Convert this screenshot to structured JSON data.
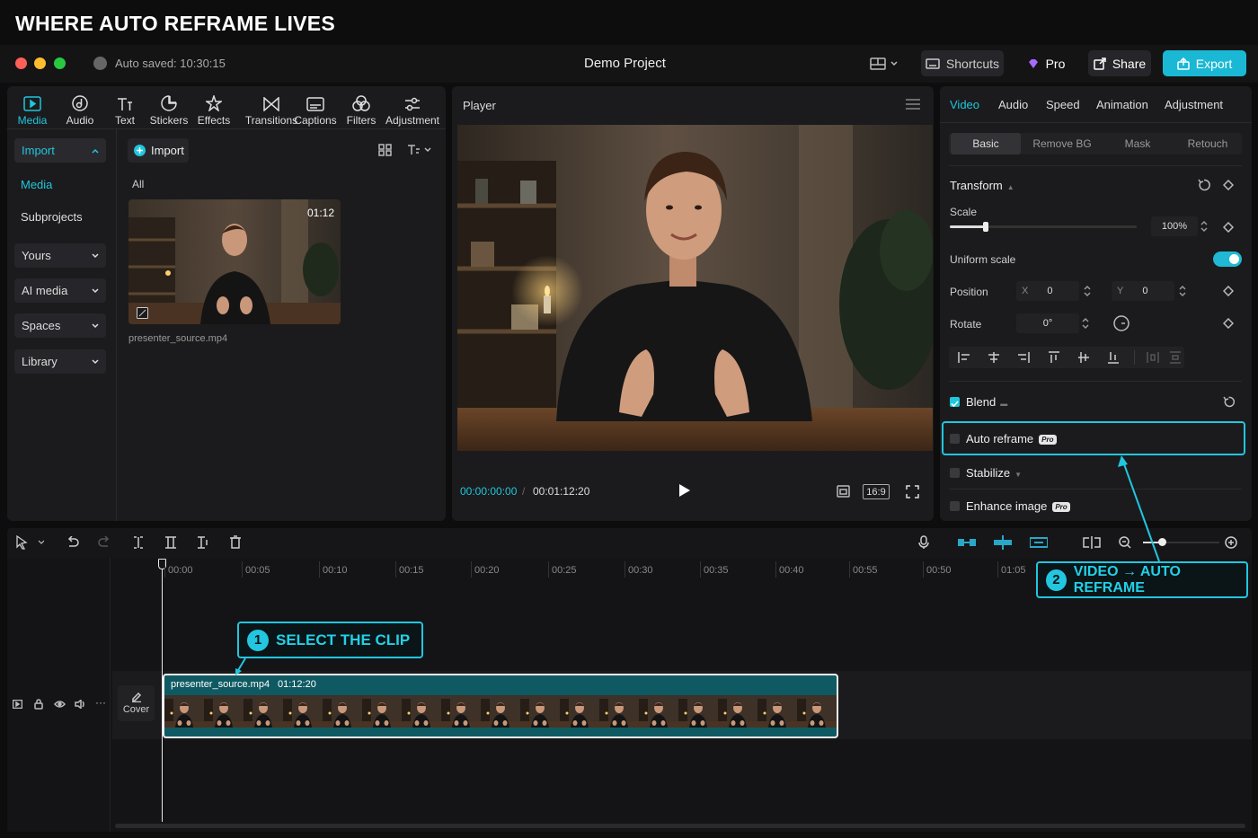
{
  "heading": "WHERE AUTO REFRAME LIVES",
  "titlebar": {
    "autosave": "Auto saved: 10:30:15",
    "project": "Demo Project",
    "shortcuts": "Shortcuts",
    "pro": "Pro",
    "share": "Share",
    "export": "Export"
  },
  "toolbar": {
    "tabs": [
      {
        "label": "Media",
        "icon": "media-icon"
      },
      {
        "label": "Audio",
        "icon": "audio-icon"
      },
      {
        "label": "Text",
        "icon": "text-icon"
      },
      {
        "label": "Stickers",
        "icon": "stickers-icon"
      },
      {
        "label": "Effects",
        "icon": "effects-icon"
      },
      {
        "label": "Transitions",
        "icon": "transitions-icon"
      },
      {
        "label": "Captions",
        "icon": "captions-icon"
      },
      {
        "label": "Filters",
        "icon": "filters-icon"
      },
      {
        "label": "Adjustment",
        "icon": "adjustment-icon"
      }
    ]
  },
  "sidebar": {
    "import": "Import",
    "media": "Media",
    "subprojects": "Subprojects",
    "dropdowns": [
      "Yours",
      "AI media",
      "Spaces",
      "Library"
    ]
  },
  "media": {
    "import_button": "Import",
    "filter": "All",
    "clip_duration": "01:12",
    "clip_name": "presenter_source.mp4"
  },
  "player": {
    "title": "Player",
    "current_time": "00:00:00:00",
    "total_time": "00:01:12:20",
    "ratio": "16:9"
  },
  "right_panel": {
    "tabs": [
      "Video",
      "Audio",
      "Speed",
      "Animation",
      "Adjustment"
    ],
    "subtabs": [
      "Basic",
      "Remove BG",
      "Mask",
      "Retouch"
    ],
    "transform": "Transform",
    "scale_label": "Scale",
    "scale_value": "100%",
    "scale_level": 0.19,
    "uniform_scale": "Uniform scale",
    "position_label": "Position",
    "x_label": "X",
    "x_value": "0",
    "y_label": "Y",
    "y_value": "0",
    "rotate_label": "Rotate",
    "rotate_value": "0°",
    "blend": "Blend",
    "auto_reframe": "Auto reframe",
    "stabilize": "Stabilize",
    "enhance_image": "Enhance image",
    "pro_badge": "Pro"
  },
  "timeline": {
    "ticks": [
      "00:00",
      "00:05",
      "00:10",
      "00:15",
      "00:20",
      "00:25",
      "00:30",
      "00:35",
      "00:40",
      "00:55",
      "00:50",
      "01:05"
    ],
    "cover": "Cover",
    "clip_name": "presenter_source.mp4",
    "clip_duration": "01:12:20"
  },
  "callouts": {
    "step1_num": "1",
    "step1": "SELECT THE CLIP",
    "step2_num": "2",
    "step2": "VIDEO → AUTO REFRAME"
  },
  "colors": {
    "accent": "#22c6e0",
    "export": "#1ab8d4",
    "clip": "#0f5a62"
  }
}
